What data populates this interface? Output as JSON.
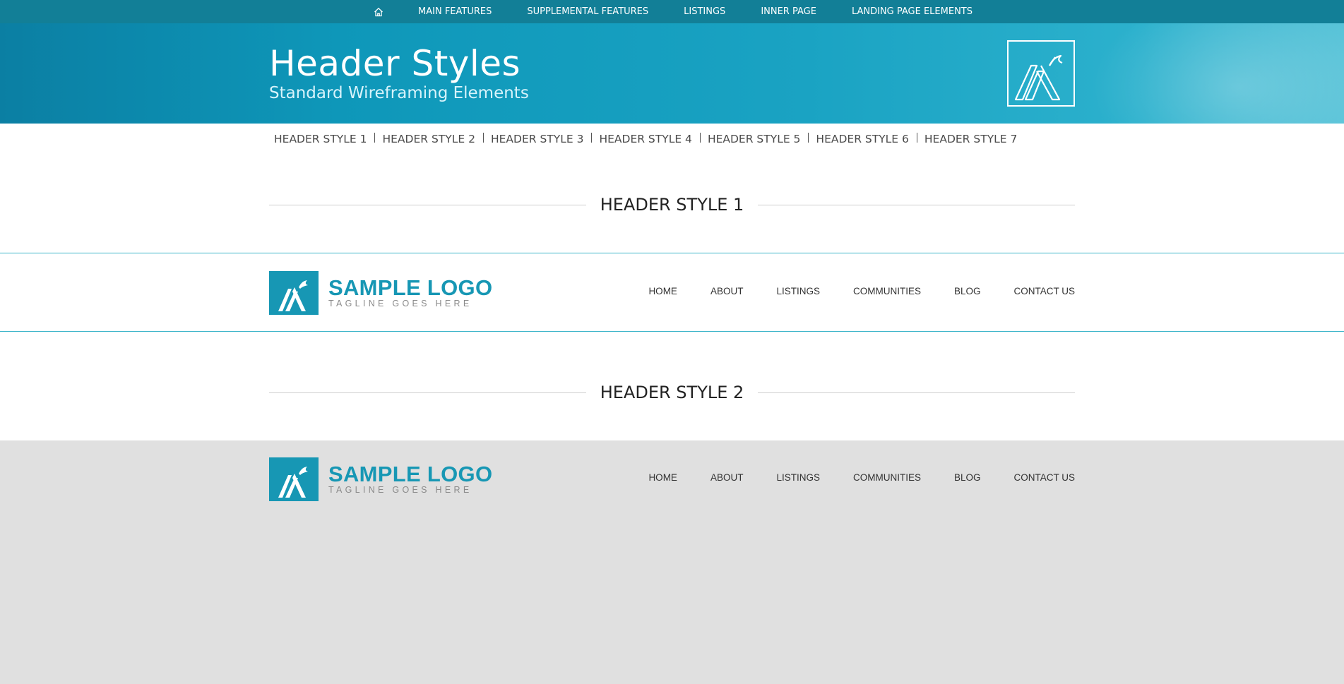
{
  "topnav": {
    "home_icon": "home-icon",
    "items": [
      "MAIN FEATURES",
      "SUPPLEMENTAL FEATURES",
      "LISTINGS",
      "INNER PAGE",
      "LANDING PAGE ELEMENTS"
    ]
  },
  "hero": {
    "title": "Header Styles",
    "subtitle": "Standard Wireframing Elements",
    "logo_icon": "brand-logo-icon"
  },
  "sublinks": [
    "HEADER STYLE 1",
    "HEADER STYLE 2",
    "HEADER STYLE 3",
    "HEADER STYLE 4",
    "HEADER STYLE 5",
    "HEADER STYLE 6",
    "HEADER STYLE 7"
  ],
  "sections": [
    {
      "heading": "HEADER STYLE 1",
      "brand": {
        "name": "SAMPLE LOGO",
        "tagline": "TAGLINE GOES HERE"
      },
      "nav": [
        "HOME",
        "ABOUT",
        "LISTINGS",
        "COMMUNITIES",
        "BLOG",
        "CONTACT US"
      ]
    },
    {
      "heading": "HEADER STYLE 2",
      "brand": {
        "name": "SAMPLE LOGO",
        "tagline": "TAGLINE GOES HERE"
      },
      "nav": [
        "HOME",
        "ABOUT",
        "LISTINGS",
        "COMMUNITIES",
        "BLOG",
        "CONTACT US"
      ]
    }
  ],
  "colors": {
    "topnav_bg": "#127f97",
    "brand_blue": "#1797b4",
    "accent_line": "#3bb4c9",
    "page_gray": "#e0e0e0"
  }
}
